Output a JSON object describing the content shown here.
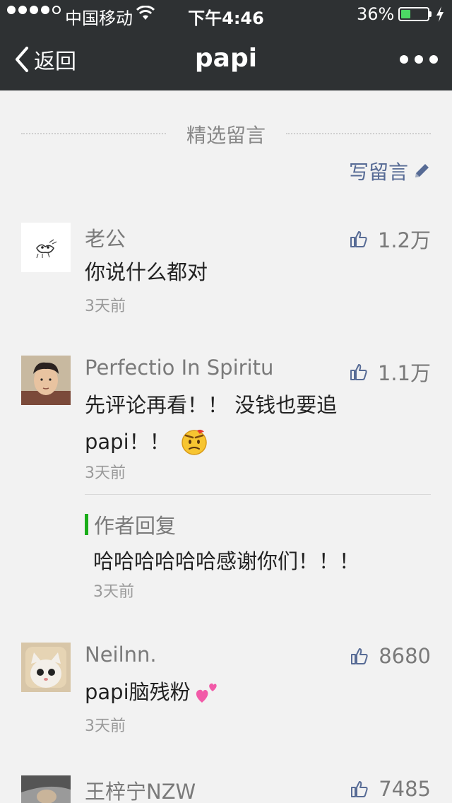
{
  "status_bar": {
    "carrier": "中国移动",
    "time": "下午4:46",
    "battery_percent": "36%",
    "battery_level": 0.36,
    "signal_dots_filled": 4,
    "signal_dots_total": 5
  },
  "nav": {
    "back_label": "返回",
    "title": "papi"
  },
  "section": {
    "title": "精选留言",
    "write_label": "写留言"
  },
  "colors": {
    "nav_bg": "#2e3133",
    "link": "#576b95",
    "reply_accent": "#1aad19",
    "battery": "#4cd964"
  },
  "comments": [
    {
      "name": "老公",
      "likes": "1.2万",
      "content_lines": [
        "你说什么都对"
      ],
      "time": "3天前"
    },
    {
      "name": "Perfectio In Spiritu",
      "likes": "1.1万",
      "content_lines": [
        "先评论再看！！ 没钱也要追",
        "papi！！"
      ],
      "emoji": "frowning-face-emoji",
      "time": "3天前",
      "reply": {
        "label": "作者回复",
        "content": "哈哈哈哈哈哈感谢你们！！！",
        "time": "3天前"
      }
    },
    {
      "name": "Neilnn.",
      "likes": "8680",
      "content_lines": [
        "papi脑残粉"
      ],
      "emoji": "two-hearts-emoji",
      "time": "3天前"
    },
    {
      "name": "王梓宁NZW",
      "likes": "7485"
    }
  ]
}
